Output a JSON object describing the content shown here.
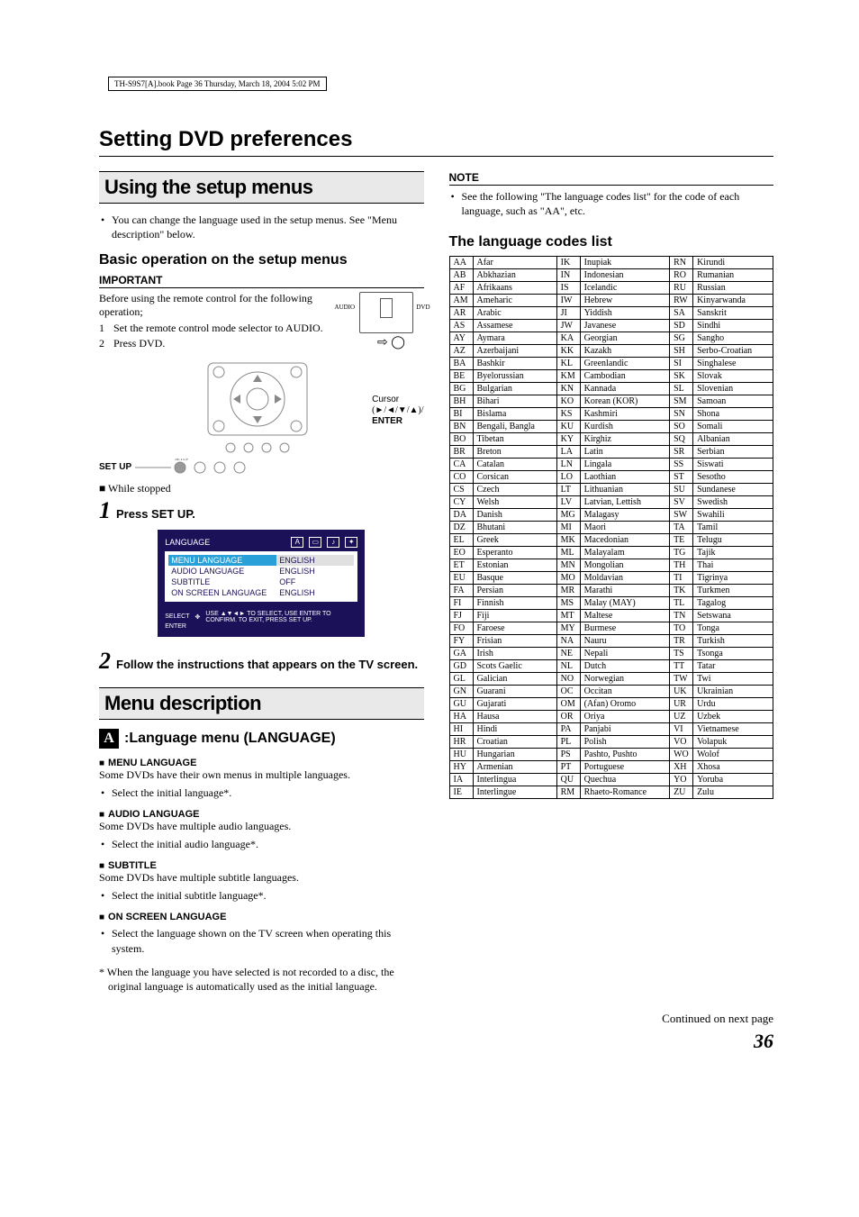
{
  "header_line": "TH-S9S7[A].book  Page 36  Thursday, March 18, 2004  5:02 PM",
  "page_title": "Setting DVD preferences",
  "left": {
    "h_using": "Using the setup menus",
    "using_bullet": "You can change the language used in the setup menus. See \"Menu description\" below.",
    "h_basic": "Basic operation on the setup menus",
    "important_label": "IMPORTANT",
    "before_text": "Before using the remote control for the following operation;",
    "step_items": [
      {
        "n": "1",
        "t": "Set the remote control mode selector to AUDIO."
      },
      {
        "n": "2",
        "t": "Press DVD."
      }
    ],
    "switch": {
      "audio": "AUDIO",
      "dvd": "DVD"
    },
    "remote": {
      "cursor": "Cursor",
      "arrows": "(►/◄/▼/▲)/",
      "enter": "ENTER",
      "setup": "SET UP",
      "setup_small": "SETUP"
    },
    "while_stopped_prefix": "■ ",
    "while_stopped": "While stopped",
    "step1_num": "1",
    "step1_text": "Press SET UP.",
    "osd": {
      "title": "LANGUAGE",
      "rows": [
        {
          "k": "MENU LANGUAGE",
          "v": "ENGLISH",
          "hl": true
        },
        {
          "k": "AUDIO LANGUAGE",
          "v": "ENGLISH"
        },
        {
          "k": "SUBTITLE",
          "v": "OFF"
        },
        {
          "k": "ON SCREEN LANGUAGE",
          "v": "ENGLISH"
        }
      ],
      "foot_l": "SELECT",
      "foot_l2": "ENTER",
      "foot_r": "USE ▲▼◄► TO SELECT, USE ENTER TO CONFIRM. TO EXIT, PRESS SET UP."
    },
    "step2_num": "2",
    "step2_text": "Follow the instructions that appears on the TV screen.",
    "h_menu_desc": "Menu description",
    "lang_menu_heading": ":Language menu (LANGUAGE)",
    "blocks": [
      {
        "h": "MENU LANGUAGE",
        "t": "Some DVDs have their own menus in multiple languages.",
        "b": "Select the initial language*."
      },
      {
        "h": "AUDIO LANGUAGE",
        "t": "Some DVDs have multiple audio languages.",
        "b": "Select the initial audio language*."
      },
      {
        "h": "SUBTITLE",
        "t": "Some DVDs have multiple subtitle languages.",
        "b": "Select the initial subtitle language*."
      },
      {
        "h": "ON SCREEN LANGUAGE",
        "t": "",
        "b": "Select the language shown on the TV screen when operating this system."
      }
    ],
    "footnote": "* When the language you have selected is not recorded to a disc, the original language is automatically used as the initial language."
  },
  "right": {
    "note_label": "NOTE",
    "note_bullet": "See the following \"The language codes list\" for the code of each language, such as \"AA\", etc.",
    "h_codes": "The language codes list",
    "codes_col1": [
      [
        "AA",
        "Afar"
      ],
      [
        "AB",
        "Abkhazian"
      ],
      [
        "AF",
        "Afrikaans"
      ],
      [
        "AM",
        "Ameharic"
      ],
      [
        "AR",
        "Arabic"
      ],
      [
        "AS",
        "Assamese"
      ],
      [
        "AY",
        "Aymara"
      ],
      [
        "AZ",
        "Azerbaijani"
      ],
      [
        "BA",
        "Bashkir"
      ],
      [
        "BE",
        "Byelorussian"
      ],
      [
        "BG",
        "Bulgarian"
      ],
      [
        "BH",
        "Bihari"
      ],
      [
        "BI",
        "Bislama"
      ],
      [
        "BN",
        "Bengali, Bangla"
      ],
      [
        "BO",
        "Tibetan"
      ],
      [
        "BR",
        "Breton"
      ],
      [
        "CA",
        "Catalan"
      ],
      [
        "CO",
        "Corsican"
      ],
      [
        "CS",
        "Czech"
      ],
      [
        "CY",
        "Welsh"
      ],
      [
        "DA",
        "Danish"
      ],
      [
        "DZ",
        "Bhutani"
      ],
      [
        "EL",
        "Greek"
      ],
      [
        "EO",
        "Esperanto"
      ],
      [
        "ET",
        "Estonian"
      ],
      [
        "EU",
        "Basque"
      ],
      [
        "FA",
        "Persian"
      ],
      [
        "FI",
        "Finnish"
      ],
      [
        "FJ",
        "Fiji"
      ],
      [
        "FO",
        "Faroese"
      ],
      [
        "FY",
        "Frisian"
      ],
      [
        "GA",
        "Irish"
      ],
      [
        "GD",
        "Scots Gaelic"
      ],
      [
        "GL",
        "Galician"
      ],
      [
        "GN",
        "Guarani"
      ],
      [
        "GU",
        "Gujarati"
      ],
      [
        "HA",
        "Hausa"
      ],
      [
        "HI",
        "Hindi"
      ],
      [
        "HR",
        "Croatian"
      ],
      [
        "HU",
        "Hungarian"
      ],
      [
        "HY",
        "Armenian"
      ],
      [
        "IA",
        "Interlingua"
      ],
      [
        "IE",
        "Interlingue"
      ]
    ],
    "codes_col2": [
      [
        "IK",
        "Inupiak"
      ],
      [
        "IN",
        "Indonesian"
      ],
      [
        "IS",
        "Icelandic"
      ],
      [
        "IW",
        "Hebrew"
      ],
      [
        "JI",
        "Yiddish"
      ],
      [
        "JW",
        "Javanese"
      ],
      [
        "KA",
        "Georgian"
      ],
      [
        "KK",
        "Kazakh"
      ],
      [
        "KL",
        "Greenlandic"
      ],
      [
        "KM",
        "Cambodian"
      ],
      [
        "KN",
        "Kannada"
      ],
      [
        "KO",
        "Korean (KOR)"
      ],
      [
        "KS",
        "Kashmiri"
      ],
      [
        "KU",
        "Kurdish"
      ],
      [
        "KY",
        "Kirghiz"
      ],
      [
        "LA",
        "Latin"
      ],
      [
        "LN",
        "Lingala"
      ],
      [
        "LO",
        "Laothian"
      ],
      [
        "LT",
        "Lithuanian"
      ],
      [
        "LV",
        "Latvian, Lettish"
      ],
      [
        "MG",
        "Malagasy"
      ],
      [
        "MI",
        "Maori"
      ],
      [
        "MK",
        "Macedonian"
      ],
      [
        "ML",
        "Malayalam"
      ],
      [
        "MN",
        "Mongolian"
      ],
      [
        "MO",
        "Moldavian"
      ],
      [
        "MR",
        "Marathi"
      ],
      [
        "MS",
        "Malay (MAY)"
      ],
      [
        "MT",
        "Maltese"
      ],
      [
        "MY",
        "Burmese"
      ],
      [
        "NA",
        "Nauru"
      ],
      [
        "NE",
        "Nepali"
      ],
      [
        "NL",
        "Dutch"
      ],
      [
        "NO",
        "Norwegian"
      ],
      [
        "OC",
        "Occitan"
      ],
      [
        "OM",
        "(Afan) Oromo"
      ],
      [
        "OR",
        "Oriya"
      ],
      [
        "PA",
        "Panjabi"
      ],
      [
        "PL",
        "Polish"
      ],
      [
        "PS",
        "Pashto, Pushto"
      ],
      [
        "PT",
        "Portuguese"
      ],
      [
        "QU",
        "Quechua"
      ],
      [
        "RM",
        "Rhaeto-Romance"
      ]
    ],
    "codes_col3": [
      [
        "RN",
        "Kirundi"
      ],
      [
        "RO",
        "Rumanian"
      ],
      [
        "RU",
        "Russian"
      ],
      [
        "RW",
        "Kinyarwanda"
      ],
      [
        "SA",
        "Sanskrit"
      ],
      [
        "SD",
        "Sindhi"
      ],
      [
        "SG",
        "Sangho"
      ],
      [
        "SH",
        "Serbo-Croatian"
      ],
      [
        "SI",
        "Singhalese"
      ],
      [
        "SK",
        "Slovak"
      ],
      [
        "SL",
        "Slovenian"
      ],
      [
        "SM",
        "Samoan"
      ],
      [
        "SN",
        "Shona"
      ],
      [
        "SO",
        "Somali"
      ],
      [
        "SQ",
        "Albanian"
      ],
      [
        "SR",
        "Serbian"
      ],
      [
        "SS",
        "Siswati"
      ],
      [
        "ST",
        "Sesotho"
      ],
      [
        "SU",
        "Sundanese"
      ],
      [
        "SV",
        "Swedish"
      ],
      [
        "SW",
        "Swahili"
      ],
      [
        "TA",
        "Tamil"
      ],
      [
        "TE",
        "Telugu"
      ],
      [
        "TG",
        "Tajik"
      ],
      [
        "TH",
        "Thai"
      ],
      [
        "TI",
        "Tigrinya"
      ],
      [
        "TK",
        "Turkmen"
      ],
      [
        "TL",
        "Tagalog"
      ],
      [
        "TN",
        "Setswana"
      ],
      [
        "TO",
        "Tonga"
      ],
      [
        "TR",
        "Turkish"
      ],
      [
        "TS",
        "Tsonga"
      ],
      [
        "TT",
        "Tatar"
      ],
      [
        "TW",
        "Twi"
      ],
      [
        "UK",
        "Ukrainian"
      ],
      [
        "UR",
        "Urdu"
      ],
      [
        "UZ",
        "Uzbek"
      ],
      [
        "VI",
        "Vietnamese"
      ],
      [
        "VO",
        "Volapuk"
      ],
      [
        "WO",
        "Wolof"
      ],
      [
        "XH",
        "Xhosa"
      ],
      [
        "YO",
        "Yoruba"
      ],
      [
        "ZU",
        "Zulu"
      ]
    ]
  },
  "continued": "Continued on next page",
  "page_num": "36"
}
